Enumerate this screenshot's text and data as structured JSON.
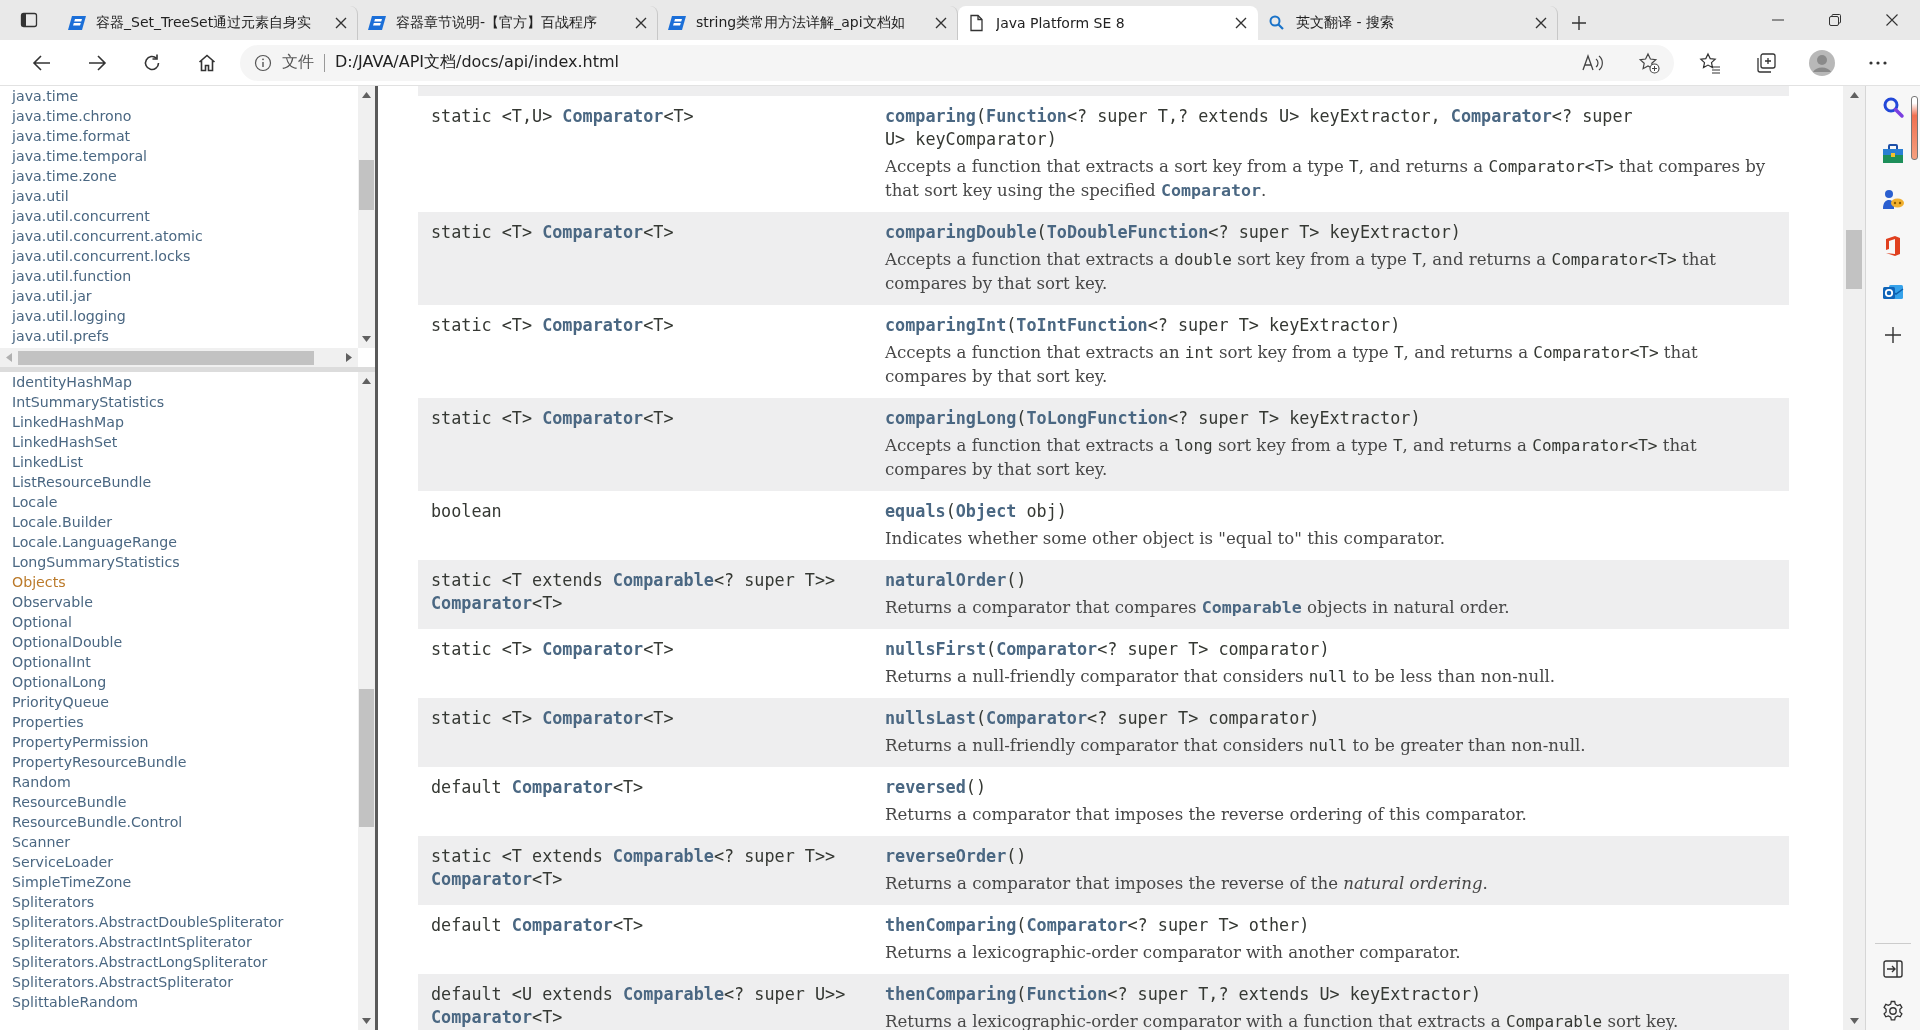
{
  "browser": {
    "tabs": [
      {
        "title": "容器_Set_TreeSet通过元素自身实",
        "kind": "blog",
        "selected": false
      },
      {
        "title": "容器章节说明-【官方】百战程序",
        "kind": "blog",
        "selected": false
      },
      {
        "title": "string类常用方法详解_api文档如",
        "kind": "blog",
        "selected": false
      },
      {
        "title": "Java Platform SE 8",
        "kind": "page",
        "selected": true
      },
      {
        "title": "英文翻译 - 搜索",
        "kind": "search",
        "selected": false
      }
    ],
    "address": {
      "label": "文件",
      "url": "D:/JAVA/API文档/docs/api/index.html"
    }
  },
  "packages": [
    "java.time",
    "java.time.chrono",
    "java.time.format",
    "java.time.temporal",
    "java.time.zone",
    "java.util",
    "java.util.concurrent",
    "java.util.concurrent.atomic",
    "java.util.concurrent.locks",
    "java.util.function",
    "java.util.jar",
    "java.util.logging",
    "java.util.prefs"
  ],
  "classes": [
    {
      "name": "IdentityHashMap",
      "selected": false
    },
    {
      "name": "IntSummaryStatistics",
      "selected": false
    },
    {
      "name": "LinkedHashMap",
      "selected": false
    },
    {
      "name": "LinkedHashSet",
      "selected": false
    },
    {
      "name": "LinkedList",
      "selected": false
    },
    {
      "name": "ListResourceBundle",
      "selected": false
    },
    {
      "name": "Locale",
      "selected": false
    },
    {
      "name": "Locale.Builder",
      "selected": false
    },
    {
      "name": "Locale.LanguageRange",
      "selected": false
    },
    {
      "name": "LongSummaryStatistics",
      "selected": false
    },
    {
      "name": "Objects",
      "selected": true
    },
    {
      "name": "Observable",
      "selected": false
    },
    {
      "name": "Optional",
      "selected": false
    },
    {
      "name": "OptionalDouble",
      "selected": false
    },
    {
      "name": "OptionalInt",
      "selected": false
    },
    {
      "name": "OptionalLong",
      "selected": false
    },
    {
      "name": "PriorityQueue",
      "selected": false
    },
    {
      "name": "Properties",
      "selected": false
    },
    {
      "name": "PropertyPermission",
      "selected": false
    },
    {
      "name": "PropertyResourceBundle",
      "selected": false
    },
    {
      "name": "Random",
      "selected": false
    },
    {
      "name": "ResourceBundle",
      "selected": false
    },
    {
      "name": "ResourceBundle.Control",
      "selected": false
    },
    {
      "name": "Scanner",
      "selected": false
    },
    {
      "name": "ServiceLoader",
      "selected": false
    },
    {
      "name": "SimpleTimeZone",
      "selected": false
    },
    {
      "name": "Spliterators",
      "selected": false
    },
    {
      "name": "Spliterators.AbstractDoubleSpliterator",
      "selected": false
    },
    {
      "name": "Spliterators.AbstractIntSpliterator",
      "selected": false
    },
    {
      "name": "Spliterators.AbstractLongSpliterator",
      "selected": false
    },
    {
      "name": "Spliterators.AbstractSpliterator",
      "selected": false
    },
    {
      "name": "SplittableRandom",
      "selected": false
    }
  ],
  "methods": [
    {
      "modifier": "static <T,U> **Comparator**<T>",
      "signature": "**comparing**(**Function**<? super T,? extends U> keyExtractor, **Comparator**<? super U> keyComparator)",
      "description": [
        {
          "kind": "text",
          "text": "Accepts a function that extracts a sort key from a type "
        },
        {
          "kind": "code",
          "text": "T"
        },
        {
          "kind": "text",
          "text": ", and returns a "
        },
        {
          "kind": "code",
          "text": "Comparator<T>"
        },
        {
          "kind": "text",
          "text": " that compares by that sort key using the specified "
        },
        {
          "kind": "link",
          "text": "Comparator"
        },
        {
          "kind": "text",
          "text": "."
        }
      ]
    },
    {
      "modifier": "static <T> **Comparator**<T>",
      "signature": "**comparingDouble**(**ToDoubleFunction**<? super T> keyExtractor)",
      "description": [
        {
          "kind": "text",
          "text": "Accepts a function that extracts a "
        },
        {
          "kind": "code",
          "text": "double"
        },
        {
          "kind": "text",
          "text": " sort key from a type "
        },
        {
          "kind": "code",
          "text": "T"
        },
        {
          "kind": "text",
          "text": ", and returns a "
        },
        {
          "kind": "code",
          "text": "Comparator<T>"
        },
        {
          "kind": "text",
          "text": " that compares by that sort key."
        }
      ]
    },
    {
      "modifier": "static <T> **Comparator**<T>",
      "signature": "**comparingInt**(**ToIntFunction**<? super T> keyExtractor)",
      "description": [
        {
          "kind": "text",
          "text": "Accepts a function that extracts an "
        },
        {
          "kind": "code",
          "text": "int"
        },
        {
          "kind": "text",
          "text": " sort key from a type "
        },
        {
          "kind": "code",
          "text": "T"
        },
        {
          "kind": "text",
          "text": ", and returns a "
        },
        {
          "kind": "code",
          "text": "Comparator<T>"
        },
        {
          "kind": "text",
          "text": " that compares by that sort key."
        }
      ]
    },
    {
      "modifier": "static <T> **Comparator**<T>",
      "signature": "**comparingLong**(**ToLongFunction**<? super T> keyExtractor)",
      "description": [
        {
          "kind": "text",
          "text": "Accepts a function that extracts a "
        },
        {
          "kind": "code",
          "text": "long"
        },
        {
          "kind": "text",
          "text": " sort key from a type "
        },
        {
          "kind": "code",
          "text": "T"
        },
        {
          "kind": "text",
          "text": ", and returns a "
        },
        {
          "kind": "code",
          "text": "Comparator<T>"
        },
        {
          "kind": "text",
          "text": " that compares by that sort key."
        }
      ]
    },
    {
      "modifier": "boolean",
      "signature": "**equals**(**Object** obj)",
      "description": [
        {
          "kind": "text",
          "text": "Indicates whether some other object is \"equal to\" this comparator."
        }
      ]
    },
    {
      "modifier": "static <T extends **Comparable**<? super T>> **Comparator**<T>",
      "signature": "**naturalOrder**()",
      "description": [
        {
          "kind": "text",
          "text": "Returns a comparator that compares "
        },
        {
          "kind": "link",
          "text": "Comparable"
        },
        {
          "kind": "text",
          "text": " objects in natural order."
        }
      ]
    },
    {
      "modifier": "static <T> **Comparator**<T>",
      "signature": "**nullsFirst**(**Comparator**<? super T> comparator)",
      "description": [
        {
          "kind": "text",
          "text": "Returns a null-friendly comparator that considers "
        },
        {
          "kind": "code",
          "text": "null"
        },
        {
          "kind": "text",
          "text": " to be less than non-null."
        }
      ]
    },
    {
      "modifier": "static <T> **Comparator**<T>",
      "signature": "**nullsLast**(**Comparator**<? super T> comparator)",
      "description": [
        {
          "kind": "text",
          "text": "Returns a null-friendly comparator that considers "
        },
        {
          "kind": "code",
          "text": "null"
        },
        {
          "kind": "text",
          "text": " to be greater than non-null."
        }
      ]
    },
    {
      "modifier": "default **Comparator**<T>",
      "signature": "**reversed**()",
      "description": [
        {
          "kind": "text",
          "text": "Returns a comparator that imposes the reverse ordering of this comparator."
        }
      ]
    },
    {
      "modifier": "static <T extends **Comparable**<? super T>> **Comparator**<T>",
      "signature": "**reverseOrder**()",
      "description": [
        {
          "kind": "text",
          "text": "Returns a comparator that imposes the reverse of the "
        },
        {
          "kind": "em",
          "text": "natural ordering"
        },
        {
          "kind": "text",
          "text": "."
        }
      ]
    },
    {
      "modifier": "default **Comparator**<T>",
      "signature": "**thenComparing**(**Comparator**<? super T> other)",
      "description": [
        {
          "kind": "text",
          "text": "Returns a lexicographic-order comparator with another comparator."
        }
      ]
    },
    {
      "modifier": "default <U extends **Comparable**<? super U>> **Comparator**<T>",
      "signature": "**thenComparing**(**Function**<? super T,? extends U> keyExtractor)",
      "description": [
        {
          "kind": "text",
          "text": "Returns a lexicographic-order comparator with a function that extracts a "
        },
        {
          "kind": "code",
          "text": "Comparable"
        },
        {
          "kind": "text",
          "text": " sort key."
        }
      ]
    }
  ]
}
